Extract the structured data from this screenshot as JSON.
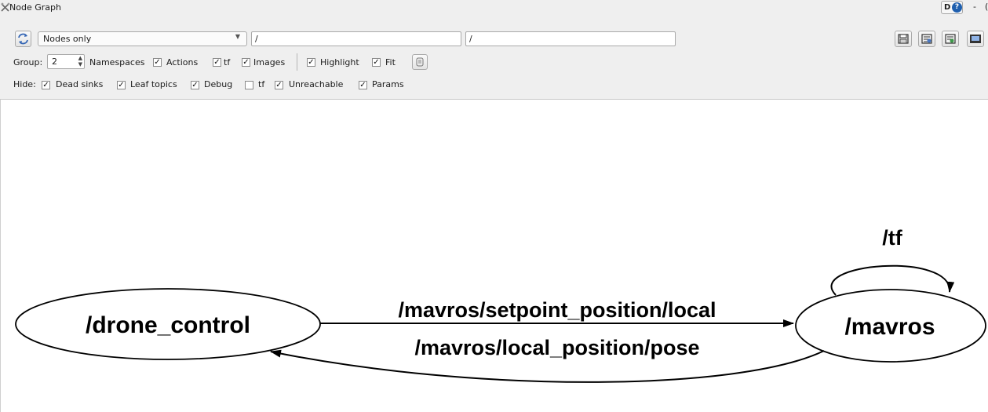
{
  "window": {
    "title": "Node Graph",
    "help_letter": "D",
    "help_icon": "help-icon",
    "controls": [
      "-",
      "("
    ]
  },
  "toolbar": {
    "refresh_icon": "refresh-icon",
    "mode": {
      "selected": "Nodes only"
    },
    "filter1": "/",
    "filter2": "/",
    "right_icons": [
      "save-icon",
      "load-dot-icon",
      "save-dot-icon",
      "screenshot-icon"
    ]
  },
  "options": {
    "group_label": "Group:",
    "group_value": "2",
    "namespaces": "Namespaces",
    "items": [
      {
        "label": "Actions",
        "checked": true
      },
      {
        "label": "tf",
        "checked": true
      },
      {
        "label": "Images",
        "checked": true
      },
      {
        "label": "Highlight",
        "checked": true
      },
      {
        "label": "Fit",
        "checked": true
      }
    ],
    "namespaces_checked": true,
    "fit_button_icon": "fit-view-icon"
  },
  "hide": {
    "label": "Hide:",
    "items": [
      {
        "label": "Dead sinks",
        "checked": true
      },
      {
        "label": "Leaf topics",
        "checked": true
      },
      {
        "label": "Debug",
        "checked": true
      },
      {
        "label": "tf",
        "checked": false
      },
      {
        "label": "Unreachable",
        "checked": true
      },
      {
        "label": "Params",
        "checked": true
      }
    ]
  },
  "graph": {
    "nodes": [
      {
        "id": "drone",
        "label": "/drone_control"
      },
      {
        "id": "mavros",
        "label": "/mavros"
      }
    ],
    "edges": [
      {
        "from": "drone",
        "to": "mavros",
        "label": "/mavros/setpoint_position/local"
      },
      {
        "from": "mavros",
        "to": "drone",
        "label": "/mavros/local_position/pose"
      },
      {
        "from": "mavros",
        "to": "mavros",
        "label": "/tf"
      }
    ],
    "colors": {
      "stroke": "#000000",
      "background": "#ffffff"
    }
  }
}
